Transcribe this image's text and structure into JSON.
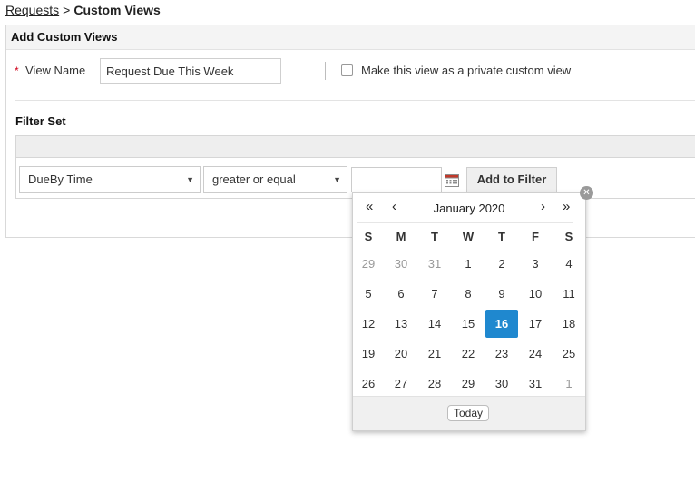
{
  "breadcrumb": {
    "parent": "Requests",
    "separator": ">",
    "current": "Custom Views"
  },
  "panel": {
    "title": "Add Custom Views"
  },
  "view_name": {
    "required_mark": "*",
    "label": "View Name",
    "value": "Request Due This Week"
  },
  "private_option": {
    "label": "Make this view as a private custom view",
    "checked": false
  },
  "filter_set": {
    "label": "Filter Set",
    "field_select": {
      "value": "DueBy Time"
    },
    "operator_select": {
      "value": "greater or equal"
    },
    "date_value": "",
    "add_button": "Add to Filter",
    "remove_icon": "close-circle-icon"
  },
  "calendar": {
    "month_label": "January 2020",
    "nav": {
      "prev_year": "«",
      "prev_month": "‹",
      "next_month": "›",
      "next_year": "»"
    },
    "weekdays": [
      "S",
      "M",
      "T",
      "W",
      "T",
      "F",
      "S"
    ],
    "weeks": [
      [
        {
          "d": "29",
          "m": true
        },
        {
          "d": "30",
          "m": true
        },
        {
          "d": "31",
          "m": true
        },
        {
          "d": "1"
        },
        {
          "d": "2"
        },
        {
          "d": "3"
        },
        {
          "d": "4"
        }
      ],
      [
        {
          "d": "5"
        },
        {
          "d": "6"
        },
        {
          "d": "7"
        },
        {
          "d": "8"
        },
        {
          "d": "9"
        },
        {
          "d": "10"
        },
        {
          "d": "11"
        }
      ],
      [
        {
          "d": "12"
        },
        {
          "d": "13"
        },
        {
          "d": "14"
        },
        {
          "d": "15"
        },
        {
          "d": "16",
          "sel": true
        },
        {
          "d": "17"
        },
        {
          "d": "18"
        }
      ],
      [
        {
          "d": "19"
        },
        {
          "d": "20"
        },
        {
          "d": "21"
        },
        {
          "d": "22"
        },
        {
          "d": "23"
        },
        {
          "d": "24"
        },
        {
          "d": "25"
        }
      ],
      [
        {
          "d": "26"
        },
        {
          "d": "27"
        },
        {
          "d": "28"
        },
        {
          "d": "29"
        },
        {
          "d": "30"
        },
        {
          "d": "31"
        },
        {
          "d": "1",
          "m": true
        }
      ]
    ],
    "selected_day": "16",
    "today_label": "Today"
  },
  "colors": {
    "accent": "#1f88cf",
    "required": "#d0021b",
    "muted": "#999999"
  }
}
